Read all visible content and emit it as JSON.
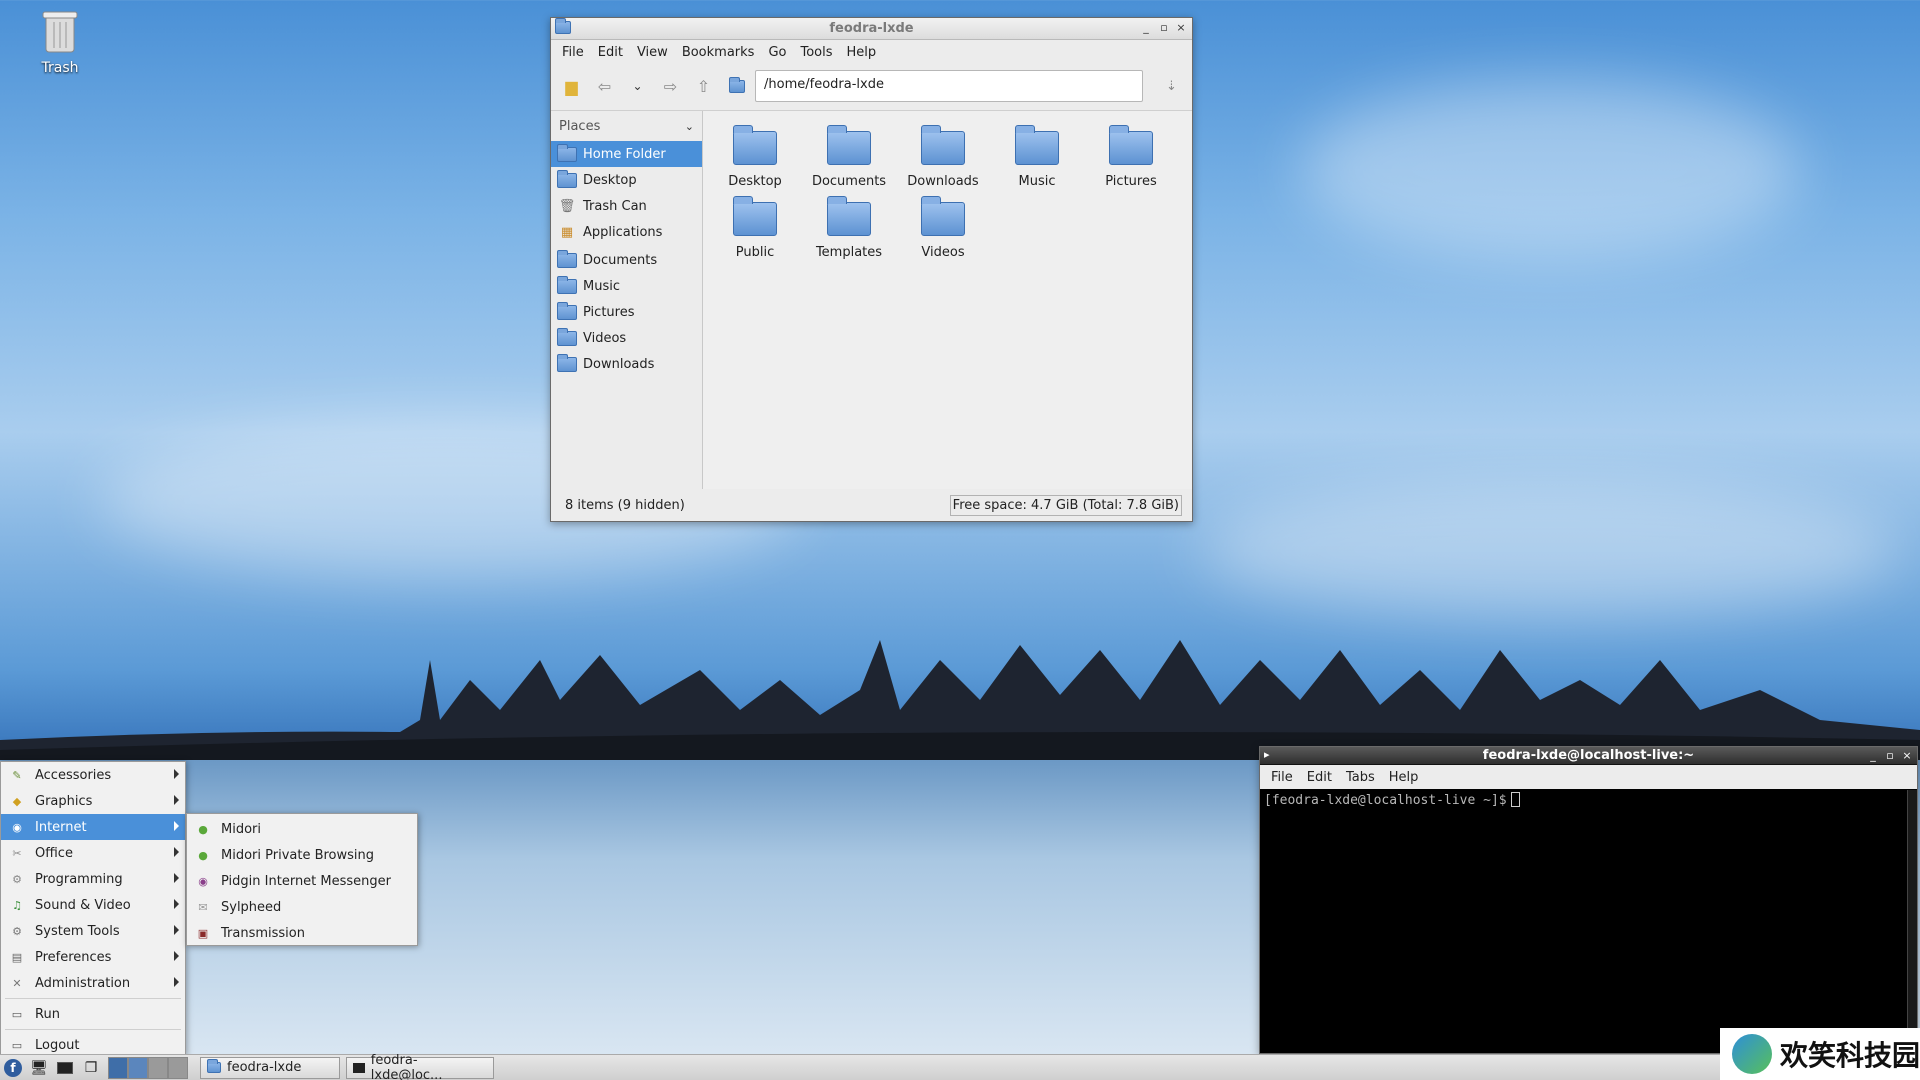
{
  "desktop": {
    "trash_label": "Trash"
  },
  "file_manager": {
    "title": "feodra-lxde",
    "menus": [
      "File",
      "Edit",
      "View",
      "Bookmarks",
      "Go",
      "Tools",
      "Help"
    ],
    "path": "/home/feodra-lxde",
    "places_label": "Places",
    "places": [
      "Home Folder",
      "Desktop",
      "Trash Can",
      "Applications"
    ],
    "bookmarks": [
      "Documents",
      "Music",
      "Pictures",
      "Videos",
      "Downloads"
    ],
    "files": [
      "Desktop",
      "Documents",
      "Downloads",
      "Music",
      "Pictures",
      "Public",
      "Templates",
      "Videos"
    ],
    "status_items": "8 items (9 hidden)",
    "status_free": "Free space: 4.7 GiB (Total: 7.8 GiB)"
  },
  "terminal": {
    "title": "feodra-lxde@localhost-live:~",
    "menus": [
      "File",
      "Edit",
      "Tabs",
      "Help"
    ],
    "prompt": "[feodra-lxde@localhost-live ~]$"
  },
  "start_menu": {
    "items": [
      "Accessories",
      "Graphics",
      "Internet",
      "Office",
      "Programming",
      "Sound & Video",
      "System Tools",
      "Preferences",
      "Administration"
    ],
    "run": "Run",
    "logout": "Logout",
    "internet_submenu": [
      "Midori",
      "Midori Private Browsing",
      "Pidgin Internet Messenger",
      "Sylpheed",
      "Transmission"
    ]
  },
  "panel": {
    "tasks": [
      "feodra-lxde",
      "feodra-lxde@loc..."
    ]
  },
  "watermark": "欢笑科技园",
  "colors": {
    "accent": "#4a90d9",
    "terminal_bg": "#000000"
  }
}
